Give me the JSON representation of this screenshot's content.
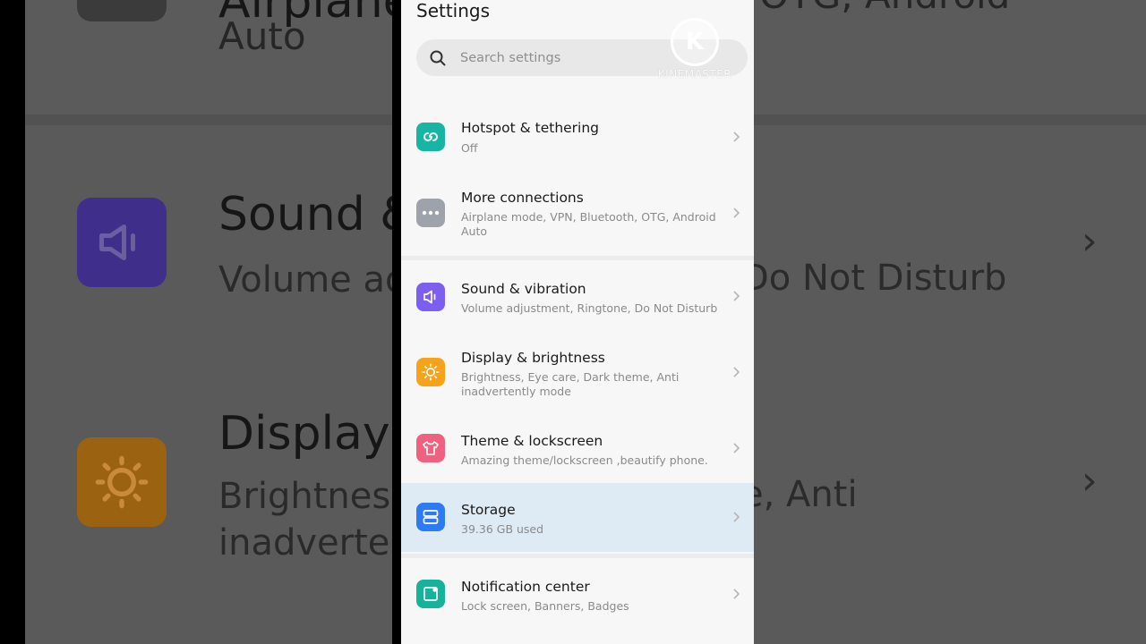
{
  "screen": {
    "title": "Settings"
  },
  "search": {
    "placeholder": "Search settings"
  },
  "watermark": {
    "logo_letter": "K",
    "text": "KINEMASTER"
  },
  "items": [
    {
      "label": "Hotspot & tethering",
      "subtitle": "Off",
      "icon": "hotspot-icon",
      "color": "#17b5a3"
    },
    {
      "label": "More connections",
      "subtitle": "Airplane mode, VPN, Bluetooth, OTG, Android Auto",
      "icon": "more-dots-icon",
      "color": "#9ea3ab"
    },
    {
      "label": "Sound & vibration",
      "subtitle": "Volume adjustment, Ringtone, Do Not Disturb",
      "icon": "speaker-icon",
      "color": "#7d5ff0"
    },
    {
      "label": "Display & brightness",
      "subtitle": "Brightness, Eye care, Dark theme, Anti inadvertently mode",
      "icon": "sun-icon",
      "color": "#f7a21b"
    },
    {
      "label": "Theme & lockscreen",
      "subtitle": "Amazing theme/lockscreen ,beautify phone.",
      "icon": "shirt-icon",
      "color": "#f0607f"
    },
    {
      "label": "Storage",
      "subtitle": "39.36 GB used",
      "icon": "storage-icon",
      "color": "#2c7bf2",
      "highlighted": true
    },
    {
      "label": "Notification center",
      "subtitle": "Lock screen, Banners, Badges",
      "icon": "notification-icon",
      "color": "#15b39a"
    }
  ],
  "background_zoom": {
    "text_top": "Airplane m",
    "text_top_right": "OTG, Android",
    "text_auto": "Auto",
    "sound_title": "Sound &",
    "sound_sub": "Volume ad",
    "sound_right": "Do Not Disturb",
    "display_title": "Display &",
    "display_sub1": "Brightness",
    "display_sub2": "inadverten",
    "display_right": "e, Anti"
  },
  "colors": {
    "panel_bg": "#f7f7f7",
    "highlight": "#deeaf4",
    "chevron": "#b5b5b5"
  }
}
